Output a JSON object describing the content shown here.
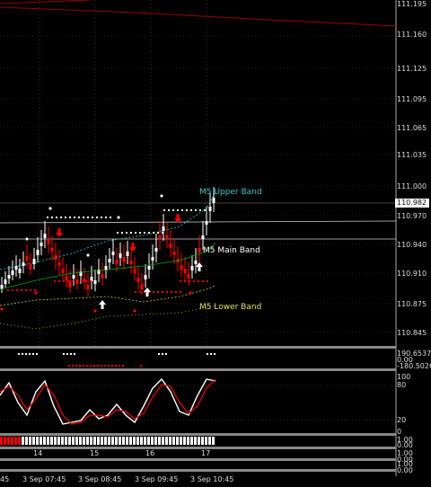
{
  "price_axis": {
    "labels": [
      "111.195",
      "111.160",
      "111.125",
      "111.095",
      "111.065",
      "111.035",
      "111.000",
      "110.970",
      "110.940",
      "110.910",
      "110.875",
      "110.845"
    ],
    "current_price": "110.982"
  },
  "band_labels": {
    "upper": "M5 Upper Band",
    "main": "M5 Main Band",
    "lower": "M5 Lower Band"
  },
  "indicator_axis": {
    "ind1_top": "190.6537",
    "ind1_mid": "0.00",
    "ind1_bot": "-180.5026",
    "stoch_top": "100",
    "stoch_80": "80",
    "stoch_20": "20",
    "stoch_0": "0",
    "bar_top": "1.00",
    "bar_bot": "0.00",
    "p3_top": "1.00",
    "p3_bot": "0.00",
    "p4_top": "1.00",
    "p4_bot": "0.00"
  },
  "hour_labels": [
    "14",
    "15",
    "16",
    "17"
  ],
  "time_labels": [
    "45",
    "3 Sep 07:45",
    "3 Sep 08:45",
    "3 Sep 09:45",
    "3 Sep 10:45"
  ],
  "colors": {
    "bull": "#ffffff",
    "bear": "#ff0000",
    "upper_band": "#33cccc",
    "main_band": "#ffffff",
    "lower_band": "#cccc33",
    "ma": "#00aa00",
    "stoch_main": "#ffffff",
    "stoch_signal": "#ff0000"
  },
  "icons": [
    "up-arrow-icon",
    "down-arrow-icon",
    "diamond-icon"
  ]
}
